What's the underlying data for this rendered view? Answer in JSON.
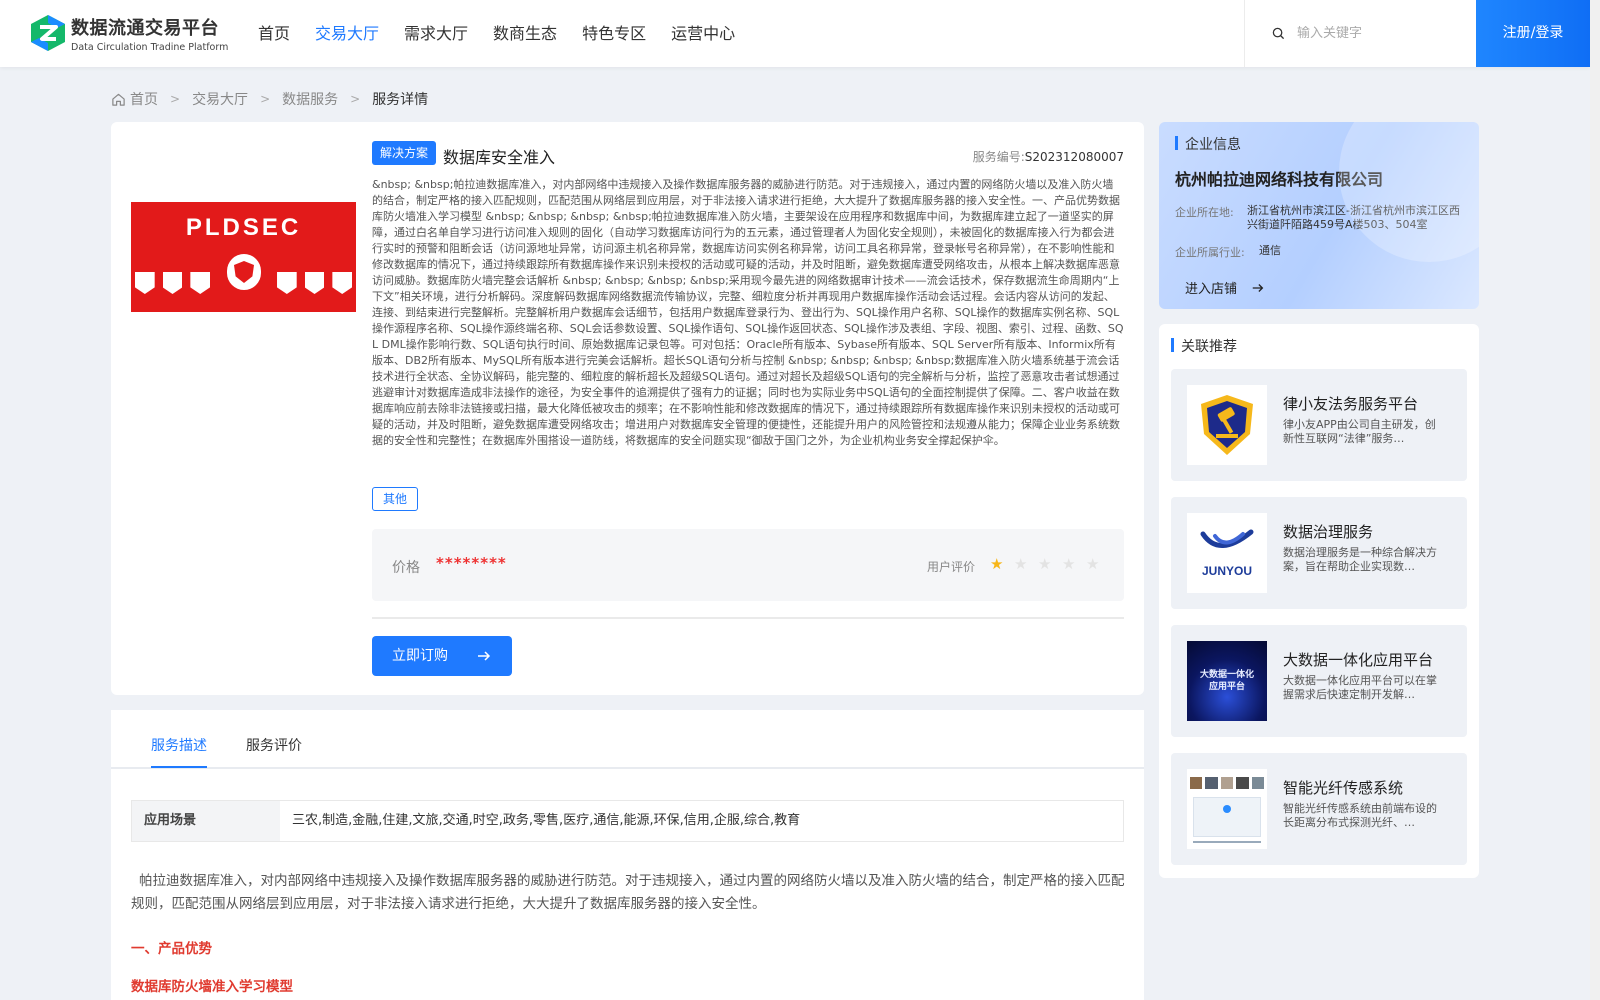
{
  "header": {
    "logo_title": "数据流通交易平台",
    "logo_subtitle": "Data Circulation Tradine Platform",
    "nav": [
      "首页",
      "交易大厅",
      "需求大厅",
      "数商生态",
      "特色专区",
      "运营中心"
    ],
    "active_nav": "交易大厅",
    "search_placeholder": "输入关键字",
    "login_label": "注册/登录"
  },
  "breadcrumb": [
    "首页",
    "交易大厅",
    "数据服务",
    "服务详情"
  ],
  "product": {
    "image_text": "PLDSEC",
    "tag": "解决方案",
    "title": "数据库安全准入",
    "service_no_label": "服务编号:",
    "service_no": "S202312080007",
    "description": "&nbsp; &nbsp;帕拉迪数据库准入，对内部网络中违规接入及操作数据库服务器的威胁进行防范。对于违规接入，通过内置的网络防火墙以及准入防火墙的结合，制定严格的接入匹配规则，匹配范围从网络层到应用层，对于非法接入请求进行拒绝，大大提升了数据库服务器的接入安全性。一、产品优势数据库防火墙准入学习模型 &nbsp; &nbsp; &nbsp; &nbsp;帕拉迪数据库准入防火墙，主要架设在应用程序和数据库中间，为数据库建立起了一道坚实的屏障，通过白名单自学习进行访问准入规则的固化（自动学习数据库访问行为的五元素，通过管理者人为固化安全规则），未被固化的数据库接入行为都会进行实时的预警和阻断会话（访问源地址异常，访问源主机名称异常，数据库访问实例名称异常，访问工具名称异常，登录帐号名称异常），在不影响性能和修改数据库的情况下，通过持续跟踪所有数据库操作来识别未授权的活动或可疑的活动，并及时阻断，避免数据库遭受网络攻击，从根本上解决数据库恶意访问威胁。数据库防火墙完整会话解析 &nbsp; &nbsp; &nbsp; &nbsp;采用现今最先进的网络数据审计技术——流会话技术，保存数据流生命周期内“上下文”相关环境，进行分析解码。深度解码数据库网络数据流传输协议，完整、细粒度分析并再现用户数据库操作活动会话过程。会话内容从访问的发起、连接、到结束进行完整解析。完整解析用户数据库会话细节，包括用户数据库登录行为、登出行为、SQL操作用户名称、SQL操作的数据库实例名称、SQL操作源程序名称、SQL操作源终端名称、SQL会话参数设置、SQL操作语句、SQL操作返回状态、SQL操作涉及表组、字段、视图、索引、过程、函数、SQL DML操作影响行数、SQL语句执行时间、原始数据库记录包等。可对包括：Oracle所有版本、Sybase所有版本、SQL Server所有版本、Informix所有版本、DB2所有版本、MySQL所有版本进行完美会话解析。超长SQL语句分析与控制 &nbsp; &nbsp; &nbsp; &nbsp;数据库准入防火墙系统基于流会话技术进行全状态、全协议解码，能完整的、细粒度的解析超长及超级SQL语句。通过对超长及超级SQL语句的完全解析与分析，监控了恶意攻击者试想通过逃避审计对数据库造成非法操作的途径，为安全事件的追溯提供了强有力的证据；同时也为实际业务中SQL语句的全面控制提供了保障。二、客户收益在数据库响应前去除非法链接或扫描，最大化降低被攻击的频率；在不影响性能和修改数据库的情况下，通过持续跟踪所有数据库操作来识别未授权的活动或可疑的活动，并及时阻断，避免数据库遭受网络攻击；增进用户对数据库安全管理的便捷性，还能提升用户的风险管控和法规遵从能力；保障企业业务系统数据的安全性和完整性；在数据库外围搭设一道防线，将数据库的安全问题实现“御敌于国门之外，为企业机构业务安全撑起保护伞。",
    "category_tag": "其他",
    "price_label": "价格",
    "price_value": "********",
    "rating_label": "用户评价",
    "rating": 1,
    "rating_max": 5,
    "subscribe_label": "立即订购"
  },
  "detail": {
    "tabs": [
      "服务描述",
      "服务评价"
    ],
    "active_tab": "服务描述",
    "scene_label": "应用场景",
    "scene_value": "三农,制造,金融,住建,文旅,交通,时空,政务,零售,医疗,通信,能源,环保,信用,企服,综合,教育",
    "intro": "帕拉迪数据库准入，对内部网络中违规接入及操作数据库服务器的威胁进行防范。对于违规接入，通过内置的网络防火墙以及准入防火墙的结合，制定严格的接入匹配规则，匹配范围从网络层到应用层，对于非法接入请求进行拒绝，大大提升了数据库服务器的接入安全性。",
    "heading1": "一、产品优势",
    "heading2": "数据库防火墙准入学习模型"
  },
  "company": {
    "section_title": "企业信息",
    "name": "杭州帕拉迪网络科技有限公司",
    "location_label": "企业所在地:",
    "location": "浙江省杭州市滨江区-浙江省杭州市滨江区西兴街道阡陌路459号A楼503、504室",
    "industry_label": "企业所属行业:",
    "industry": "通信",
    "store_label": "进入店铺"
  },
  "recommend": {
    "section_title": "关联推荐",
    "items": [
      {
        "title": "律小友法务服务平台",
        "desc": "律小友APP由公司自主研发，创新性互联网“法律”服务…",
        "icon": "gavel-shield-icon"
      },
      {
        "title": "数据治理服务",
        "desc": "数据治理服务是一种综合解决方案，旨在帮助企业实现数…",
        "thumb_text": "JUNYOU",
        "icon": "junyou-logo"
      },
      {
        "title": "大数据一体化应用平台",
        "desc": "大数据一体化应用平台可以在掌握需求后快速定制开发解…",
        "thumb_text": "大数据一体化应用平台",
        "icon": "bigdata-thumb"
      },
      {
        "title": "智能光纤传感系统",
        "desc": "智能光纤传感系统由前端布设的长距离分布式探测光纤、…",
        "icon": "fiber-thumb"
      }
    ]
  },
  "colors": {
    "primary": "#1f7aff",
    "red": "#e21a1a",
    "star": "#f7b619"
  }
}
